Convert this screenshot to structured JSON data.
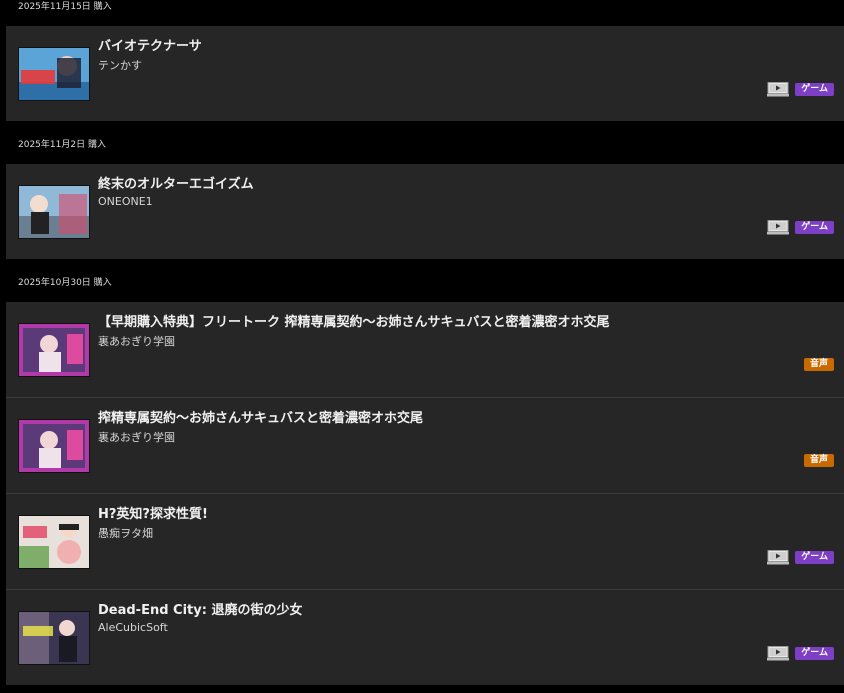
{
  "groups": [
    {
      "date": "2025年11月15日 購入",
      "items": [
        {
          "title": "バイオテクナーサ",
          "maker": "テンかす",
          "badge": "ゲーム",
          "badge_type": "game",
          "pc_icon": true
        }
      ]
    },
    {
      "date": "2025年11月2日 購入",
      "items": [
        {
          "title": "終末のオルターエゴイズム",
          "maker": "ONEONE1",
          "badge": "ゲーム",
          "badge_type": "game",
          "pc_icon": true
        }
      ]
    },
    {
      "date": "2025年10月30日 購入",
      "items": [
        {
          "title": "【早期購入特典】フリートーク 搾精専属契約～お姉さんサキュバスと密着濃密オホ交尾",
          "maker": "裏あおぎり学園",
          "badge": "音声",
          "badge_type": "voice",
          "pc_icon": false
        },
        {
          "title": "搾精専属契約～お姉さんサキュバスと密着濃密オホ交尾",
          "maker": "裏あおぎり学園",
          "badge": "音声",
          "badge_type": "voice",
          "pc_icon": false
        },
        {
          "title": "H?英知?探求性質!",
          "maker": "愚痴ヲタ畑",
          "badge": "ゲーム",
          "badge_type": "game",
          "pc_icon": true
        },
        {
          "title": "Dead-End City: 退廃の街の少女",
          "maker": "AleCubicSoft",
          "badge": "ゲーム",
          "badge_type": "game",
          "pc_icon": true
        }
      ]
    }
  ]
}
